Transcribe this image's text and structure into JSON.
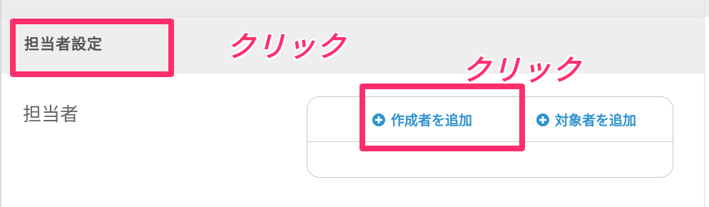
{
  "section": {
    "title": "担当者設定"
  },
  "field": {
    "label": "担当者"
  },
  "actions": {
    "add_creator": {
      "label": "作成者を追加",
      "icon": "plus-circle-icon"
    },
    "add_target": {
      "label": "対象者を追加",
      "icon": "plus-circle-icon"
    }
  },
  "annotations": {
    "click_1": "クリック",
    "click_2": "クリック"
  },
  "colors": {
    "accent": "#2f93cf",
    "highlight": "#ff2e6d",
    "header_bg": "#eeeeee"
  }
}
